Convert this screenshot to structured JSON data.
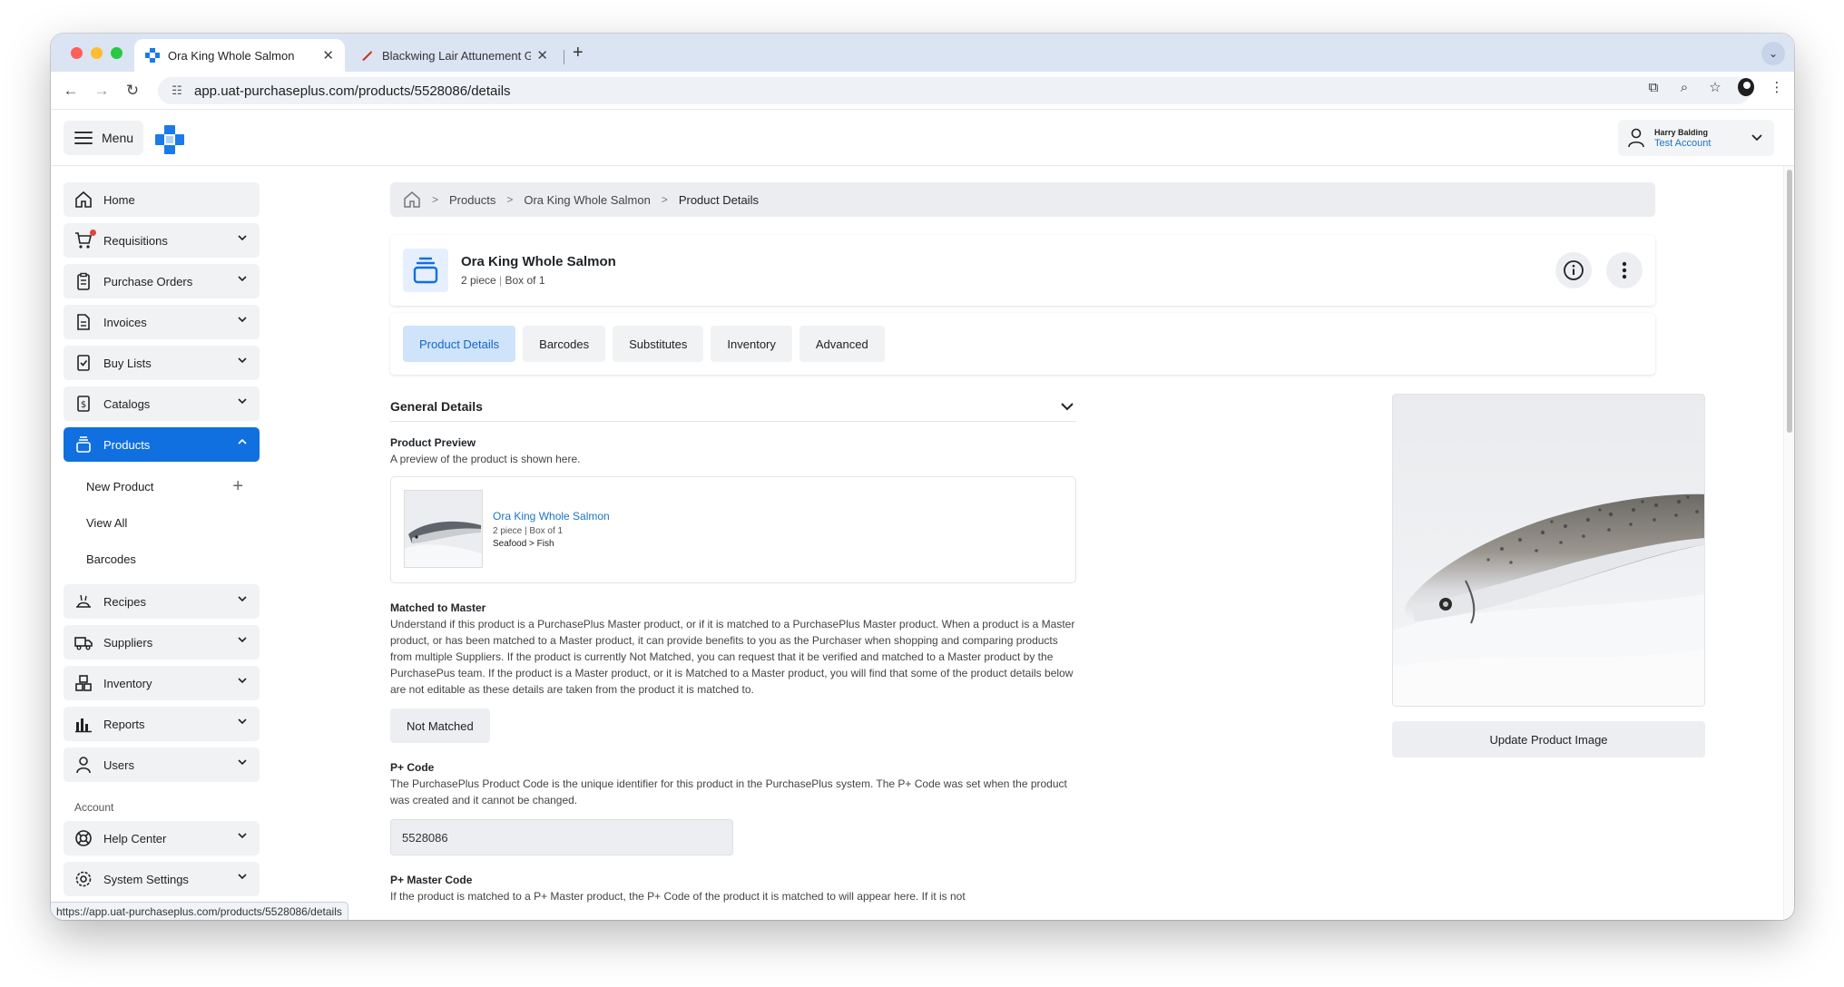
{
  "browser": {
    "tabs": [
      {
        "title": "Ora King Whole Salmon",
        "active": true
      },
      {
        "title": "Blackwing Lair Attunement G",
        "active": false
      }
    ],
    "url": "app.uat-purchaseplus.com/products/5528086/details",
    "status_url": "https://app.uat-purchaseplus.com/products/5528086/details"
  },
  "header": {
    "menu_label": "Menu",
    "user_name": "Harry Balding",
    "user_account": "Test Account"
  },
  "sidebar": {
    "items": [
      {
        "label": "Home",
        "icon": "home-icon"
      },
      {
        "label": "Requisitions",
        "icon": "cart-icon"
      },
      {
        "label": "Purchase Orders",
        "icon": "clipboard-icon"
      },
      {
        "label": "Invoices",
        "icon": "document-icon"
      },
      {
        "label": "Buy Lists",
        "icon": "checklist-icon"
      },
      {
        "label": "Catalogs",
        "icon": "dollar-doc-icon"
      },
      {
        "label": "Products",
        "icon": "products-icon"
      }
    ],
    "products_sub": [
      {
        "label": "New Product"
      },
      {
        "label": "View All"
      },
      {
        "label": "Barcodes"
      }
    ],
    "items_after": [
      {
        "label": "Recipes",
        "icon": "recipe-icon"
      },
      {
        "label": "Suppliers",
        "icon": "truck-icon"
      },
      {
        "label": "Inventory",
        "icon": "boxes-icon"
      },
      {
        "label": "Reports",
        "icon": "chart-icon"
      },
      {
        "label": "Users",
        "icon": "user-icon"
      }
    ],
    "account_label": "Account",
    "account_items": [
      {
        "label": "Help Center",
        "icon": "lifebuoy-icon"
      },
      {
        "label": "System Settings",
        "icon": "gear-icon"
      }
    ]
  },
  "breadcrumb": {
    "items": [
      "Products",
      "Ora King Whole Salmon",
      "Product Details"
    ]
  },
  "product": {
    "name": "Ora King Whole Salmon",
    "quantity": "2 piece",
    "pack": "Box of 1"
  },
  "tabs": [
    "Product Details",
    "Barcodes",
    "Substitutes",
    "Inventory",
    "Advanced"
  ],
  "general": {
    "section_title": "General Details",
    "preview_label": "Product Preview",
    "preview_desc": "A preview of the product is shown here.",
    "preview_name": "Ora King Whole Salmon",
    "preview_meta": "2 piece | Box of 1",
    "preview_category": "Seafood > Fish",
    "matched_label": "Matched to Master",
    "matched_desc": "Understand if this product is a PurchasePlus Master product, or if it is matched to a PurchasePlus Master product. When a product is a Master product, or has been matched to a Master product, it can provide benefits to you as the Purchaser when shopping and comparing products from multiple Suppliers. If the product is currently Not Matched, you can request that it be verified and matched to a Master product by the PurchasePus team. If the product is a Master product, or it is Matched to a Master product, you will find that some of the product details below are not editable as these details are taken from the product it is matched to.",
    "matched_status": "Not Matched",
    "pcode_label": "P+ Code",
    "pcode_desc": "The PurchasePlus Product Code is the unique identifier for this product in the PurchasePlus system. The P+ Code was set when the product was created and it cannot be changed.",
    "pcode_value": "5528086",
    "master_label": "P+ Master Code",
    "master_desc": "If the product is matched to a P+ Master product, the P+ Code of the product it is matched to will appear here. If it is not"
  },
  "image_panel": {
    "update_label": "Update Product Image"
  },
  "colors": {
    "primary": "#1170e0",
    "tab_active_bg": "#cfe3fb",
    "link": "#1a73c8"
  }
}
